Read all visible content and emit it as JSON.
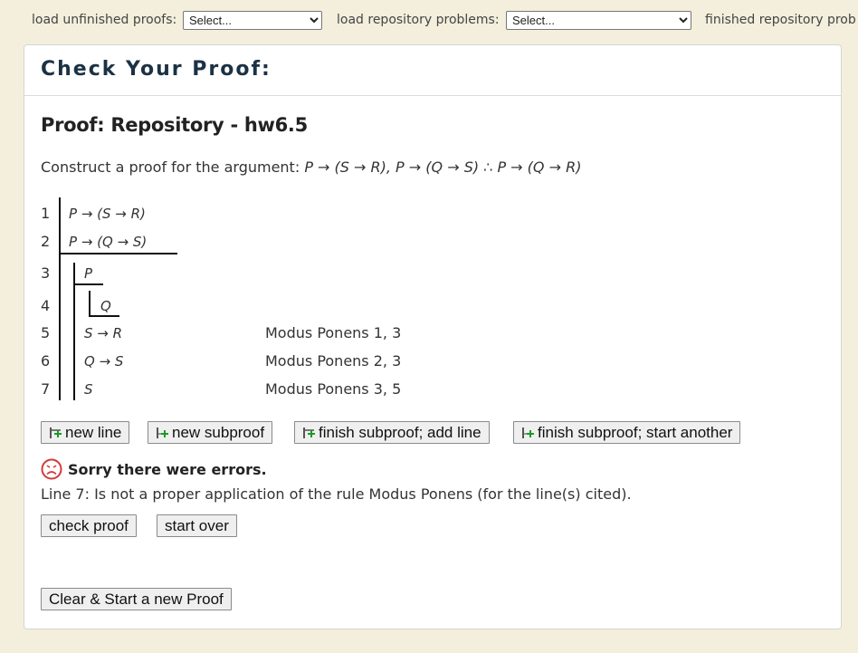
{
  "topbar": {
    "unfinished_label": "load unfinished proofs:",
    "unfinished_selected": "Select...",
    "repo_label": "load repository problems:",
    "repo_selected": "Select...",
    "finished_label": "finished repository prob"
  },
  "card": {
    "title": "Check Your Proof:"
  },
  "proof": {
    "title": "Proof: Repository - hw6.5",
    "prompt_text": "Construct a proof for the argument:",
    "argument": "P → (S → R), P → (Q → S) ∴ P → (Q → R)",
    "lines": [
      {
        "num": "1",
        "formula": "P → (S → R)",
        "justification": ""
      },
      {
        "num": "2",
        "formula": "P → (Q → S)",
        "justification": ""
      },
      {
        "num": "3",
        "formula": "P",
        "justification": ""
      },
      {
        "num": "4",
        "formula": "Q",
        "justification": ""
      },
      {
        "num": "5",
        "formula": "S → R",
        "justification": "Modus Ponens 1, 3"
      },
      {
        "num": "6",
        "formula": "Q → S",
        "justification": "Modus Ponens 2, 3"
      },
      {
        "num": "7",
        "formula": "S",
        "justification": "Modus Ponens 3, 5"
      }
    ]
  },
  "toolbar": {
    "new_line": "new line",
    "new_subproof": "new subproof",
    "finish_add_line": "finish subproof; add line",
    "finish_start_another": "finish subproof; start another"
  },
  "result": {
    "status": "Sorry there were errors.",
    "detail": "Line 7: Is not a proper application of the rule Modus Ponens (for the line(s) cited)."
  },
  "actions": {
    "check_proof": "check proof",
    "start_over": "start over",
    "clear_start": "Clear & Start a new Proof"
  },
  "colors": {
    "background": "#f3efdc",
    "title": "#1b3245",
    "plus": "#1a9a2a",
    "error_face": "#d23a3a"
  }
}
